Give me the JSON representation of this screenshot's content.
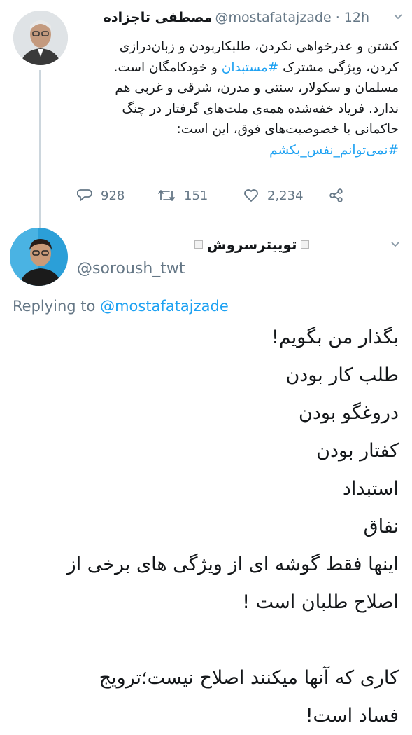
{
  "tweet1": {
    "name": "مصطفی تاجزاده",
    "handle": "@mostafatajzade",
    "time": "· 12h",
    "lines": [
      "کشتن و عذرخواهی نکردن، طلبکاربودن و زبان‌درازی",
      "ندارد. فریاد خفه‌شده همه‌ی ملت‌های گرفتار در چنگ",
      "حاکمانی با خصوصیت‌های فوق، این است:"
    ],
    "line2_pre": "کردن، ویژگی مشترک ",
    "line2_tag": "#مستبدان",
    "line2_post": " و خودکامگان است.",
    "line3": "مسلمان و سکولار، سنتی و مدرن، شرقی و غربی هم",
    "hashtag": "#نمی‌توانم_نفس_بکشم",
    "replies": "928",
    "retweets": "151",
    "likes": "2,234"
  },
  "tweet2": {
    "name": "توییترسروش",
    "handle": "@soroush_twt",
    "replying_prefix": "Replying to ",
    "replying_handle": "@mostafatajzade",
    "lines": [
      "بگذار من بگویم!",
      "طلب کار بودن",
      "دروغگو بودن",
      "کفتار بودن",
      "استبداد",
      "نفاق",
      "اینها فقط گوشه ای از ویژگی های برخی از",
      "اصلاح طلبان است !",
      "",
      "کاری که آنها میکنند اصلاح نیست؛ترویج",
      "فساد است!"
    ]
  },
  "icons": {
    "reply": "reply-icon",
    "retweet": "retweet-icon",
    "like": "heart-icon",
    "share": "share-icon",
    "more": "chevron-down-icon"
  }
}
